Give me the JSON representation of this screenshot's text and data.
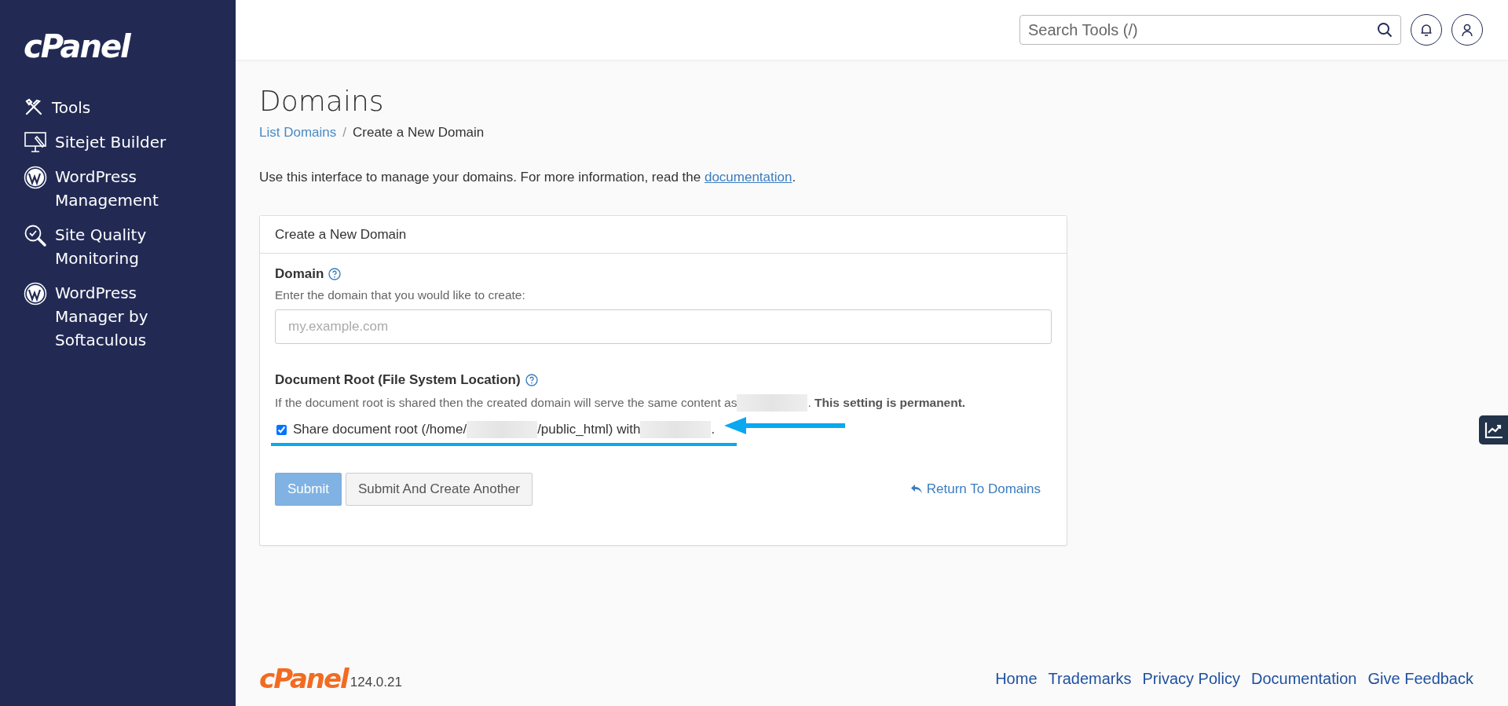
{
  "sidebar": {
    "logo": "cPanel",
    "items": [
      {
        "label": "Tools",
        "kind": "tools"
      },
      {
        "label": "Sitejet Builder",
        "kind": "builder"
      },
      {
        "label": "WordPress Management",
        "kind": "wordpress"
      },
      {
        "label": "Site Quality Monitoring",
        "kind": "monitoring"
      },
      {
        "label": "WordPress Manager by Softaculous",
        "kind": "wordpress"
      }
    ]
  },
  "header": {
    "search": {
      "placeholder": "Search Tools (/)"
    }
  },
  "page": {
    "title": "Domains",
    "breadcrumb": [
      {
        "label": "List Domains",
        "kind": "link"
      },
      {
        "label": "/",
        "kind": "separator"
      },
      {
        "label": "Create a New Domain",
        "kind": "current"
      }
    ],
    "intro": "Use this interface to manage your domains. For more information, read the ",
    "intro_link": "documentation",
    "intro_end": "."
  },
  "card": {
    "title": "Create a New Domain",
    "domain": {
      "label": "Domain",
      "hint": "Enter the domain that you would like to create:",
      "placeholder": "my.example.com"
    },
    "docroot": {
      "label": "Document Root (File System Location)",
      "desc": "If the document root is shared then the created domain will serve the same content as",
      "desc_end": ". **This setting is permanent.**",
      "share": {
        "checked": true,
        "parts": [
          "Share document root (/home/",
          "/public_html) with",
          "."
        ]
      }
    },
    "buttons": [
      {
        "label": "Submit",
        "kind": "primary",
        "disabled": true
      },
      {
        "label": "Submit And Create Another",
        "kind": "default",
        "disabled": false
      }
    ],
    "return_link": "Return To Domains"
  },
  "footer": {
    "logo": "cPanel",
    "version": "124.0.21",
    "links": [
      "Home",
      "Trademarks",
      "Privacy Policy",
      "Documentation",
      "Give Feedback"
    ]
  }
}
